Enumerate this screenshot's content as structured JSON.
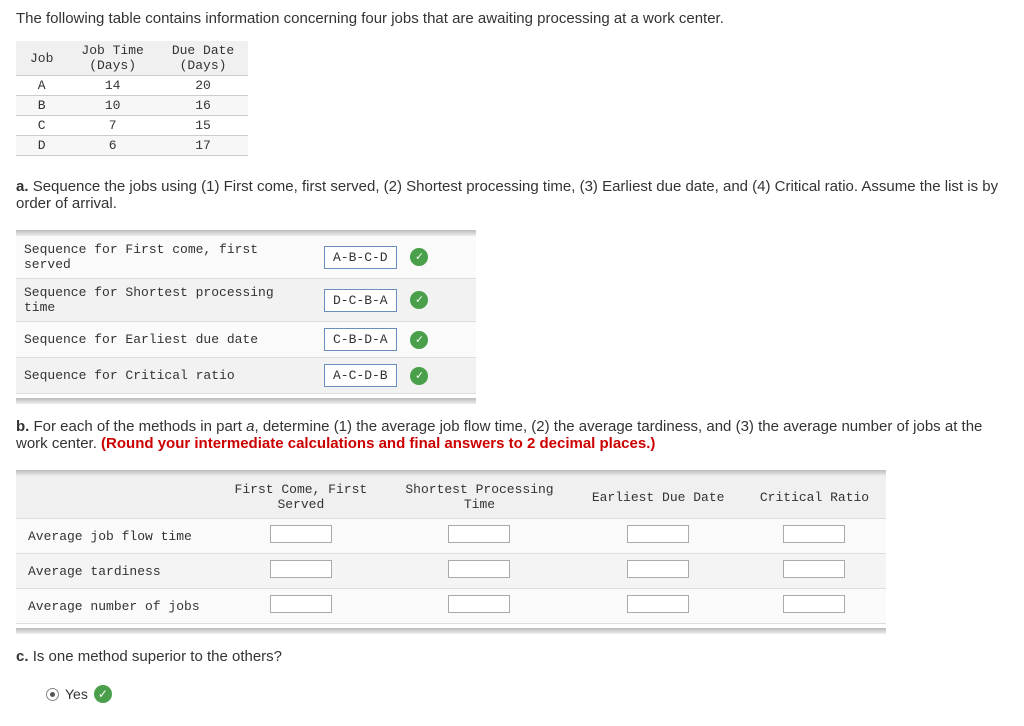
{
  "intro": "The following table contains information concerning four jobs that are awaiting processing at a work center.",
  "job_table": {
    "headers": {
      "job": "Job",
      "time": "Job Time\n(Days)",
      "due": "Due Date\n(Days)"
    },
    "rows": [
      {
        "job": "A",
        "time": "14",
        "due": "20"
      },
      {
        "job": "B",
        "time": "10",
        "due": "16"
      },
      {
        "job": "C",
        "time": "7",
        "due": "15"
      },
      {
        "job": "D",
        "time": "6",
        "due": "17"
      }
    ]
  },
  "part_a": {
    "label": "a.",
    "text": "Sequence the jobs using (1) First come, first served, (2) Shortest processing time, (3) Earliest due date, and (4) Critical ratio. Assume the list is by order of arrival.",
    "rows": [
      {
        "label": "Sequence for First come, first served",
        "value": "A-B-C-D"
      },
      {
        "label": "Sequence for Shortest processing time",
        "value": "D-C-B-A"
      },
      {
        "label": "Sequence for Earliest due date",
        "value": "C-B-D-A"
      },
      {
        "label": "Sequence for Critical ratio",
        "value": "A-C-D-B"
      }
    ]
  },
  "part_b": {
    "label": "b.",
    "text_lead": "For each of the methods in part ",
    "text_ital": "a",
    "text_tail": ", determine (1) the average job flow time, (2) the average tardiness, and (3) the average number of jobs at the work center. ",
    "note": "(Round your intermediate calculations and final answers to 2 decimal places.)",
    "col_headers": [
      "",
      "First Come, First Served",
      "Shortest Processing Time",
      "Earliest Due Date",
      "Critical Ratio"
    ],
    "row_labels": [
      "Average job flow time",
      "Average tardiness",
      "Average number of jobs"
    ]
  },
  "part_c": {
    "label": "c.",
    "text": "Is one method superior to the others?",
    "answer": "Yes"
  }
}
